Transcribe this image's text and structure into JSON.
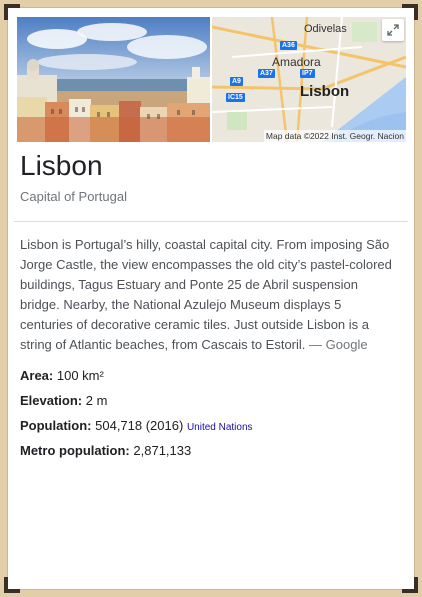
{
  "place": {
    "title": "Lisbon",
    "subtitle": "Capital of Portugal"
  },
  "map": {
    "labels": {
      "odivelas": "Odivelas",
      "amadora": "Amadora",
      "lisbon": "Lisbon"
    },
    "roads": [
      "A36",
      "A37",
      "IP7",
      "A9",
      "IC15"
    ],
    "attribution": "Map data ©2022 Inst. Geogr. Nacion"
  },
  "description": {
    "text": "Lisbon is Portugal’s hilly, coastal capital city. From imposing São Jorge Castle, the view encompasses the old city’s pastel-colored buildings, Tagus Estuary and Ponte 25 de Abril suspension bridge. Nearby, the National Azulejo Museum displays 5 centuries of decorative ceramic tiles. Just outside Lisbon is a string of Atlantic beaches, from Cascais to Estoril.",
    "source": "— Google"
  },
  "facts": {
    "area": {
      "label": "Area:",
      "value": "100 km²"
    },
    "elevation": {
      "label": "Elevation:",
      "value": "2 m"
    },
    "population": {
      "label": "Population:",
      "value": "504,718 (2016)",
      "source": "United Nations"
    },
    "metro": {
      "label": "Metro population:",
      "value": "2,871,133"
    }
  },
  "colors": {
    "frame": "#e2cfa9",
    "link": "#1a0dab",
    "road_shield": "#1a73e8"
  }
}
